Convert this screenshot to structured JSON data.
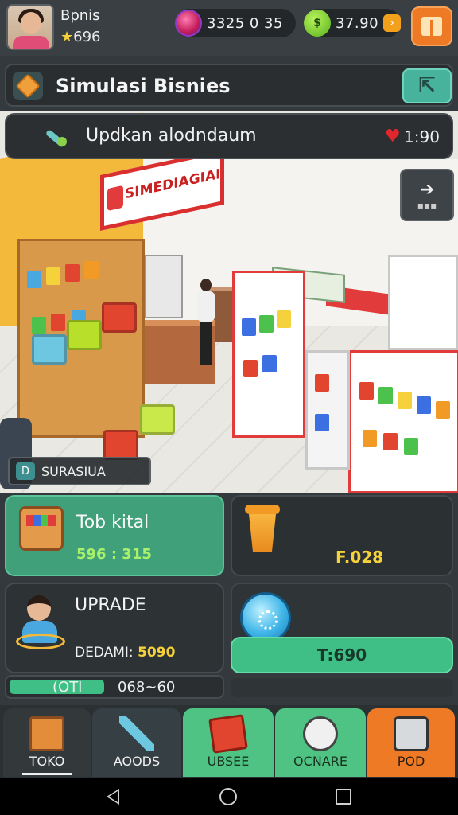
{
  "player": {
    "name": "Bpnis",
    "star_glyph": "★",
    "stars": "696"
  },
  "currency": {
    "gems_value": "3325",
    "gems_extra": "0  35",
    "coins_value": "37.90",
    "plus": "›"
  },
  "title_bar": {
    "title": "Simulasi Bisnies"
  },
  "status": {
    "text": "Updkan alodndaum",
    "heart": "♥",
    "time": "1:90"
  },
  "scene": {
    "sign_text": "SIMEDIAGIAI",
    "label": "SURASIUA",
    "label_icon": "D"
  },
  "cards": {
    "shop": {
      "title": "Tob kital",
      "value": "596 : 315"
    },
    "cup": {
      "value": "F.028"
    },
    "upgrade": {
      "title": "UPRADE",
      "label": "DEDAMI:",
      "value": "5090"
    },
    "action_button": {
      "label": "T:690"
    }
  },
  "progress": {
    "left_label": "(OTI",
    "right_label": "068~60",
    "fill_fraction": 0.45
  },
  "nav": [
    {
      "label": "TOKO",
      "icon": "box-icon"
    },
    {
      "label": "AOODS",
      "icon": "tools-icon"
    },
    {
      "label": "UBSEE",
      "icon": "book-icon"
    },
    {
      "label": "OCNARE",
      "icon": "globe-icon"
    },
    {
      "label": "POD",
      "icon": "safe-icon"
    }
  ],
  "colors": {
    "accent_green": "#3fbf86",
    "accent_orange": "#ef7a25",
    "panel_dark": "#2b3033",
    "gold": "#f5d23b"
  }
}
